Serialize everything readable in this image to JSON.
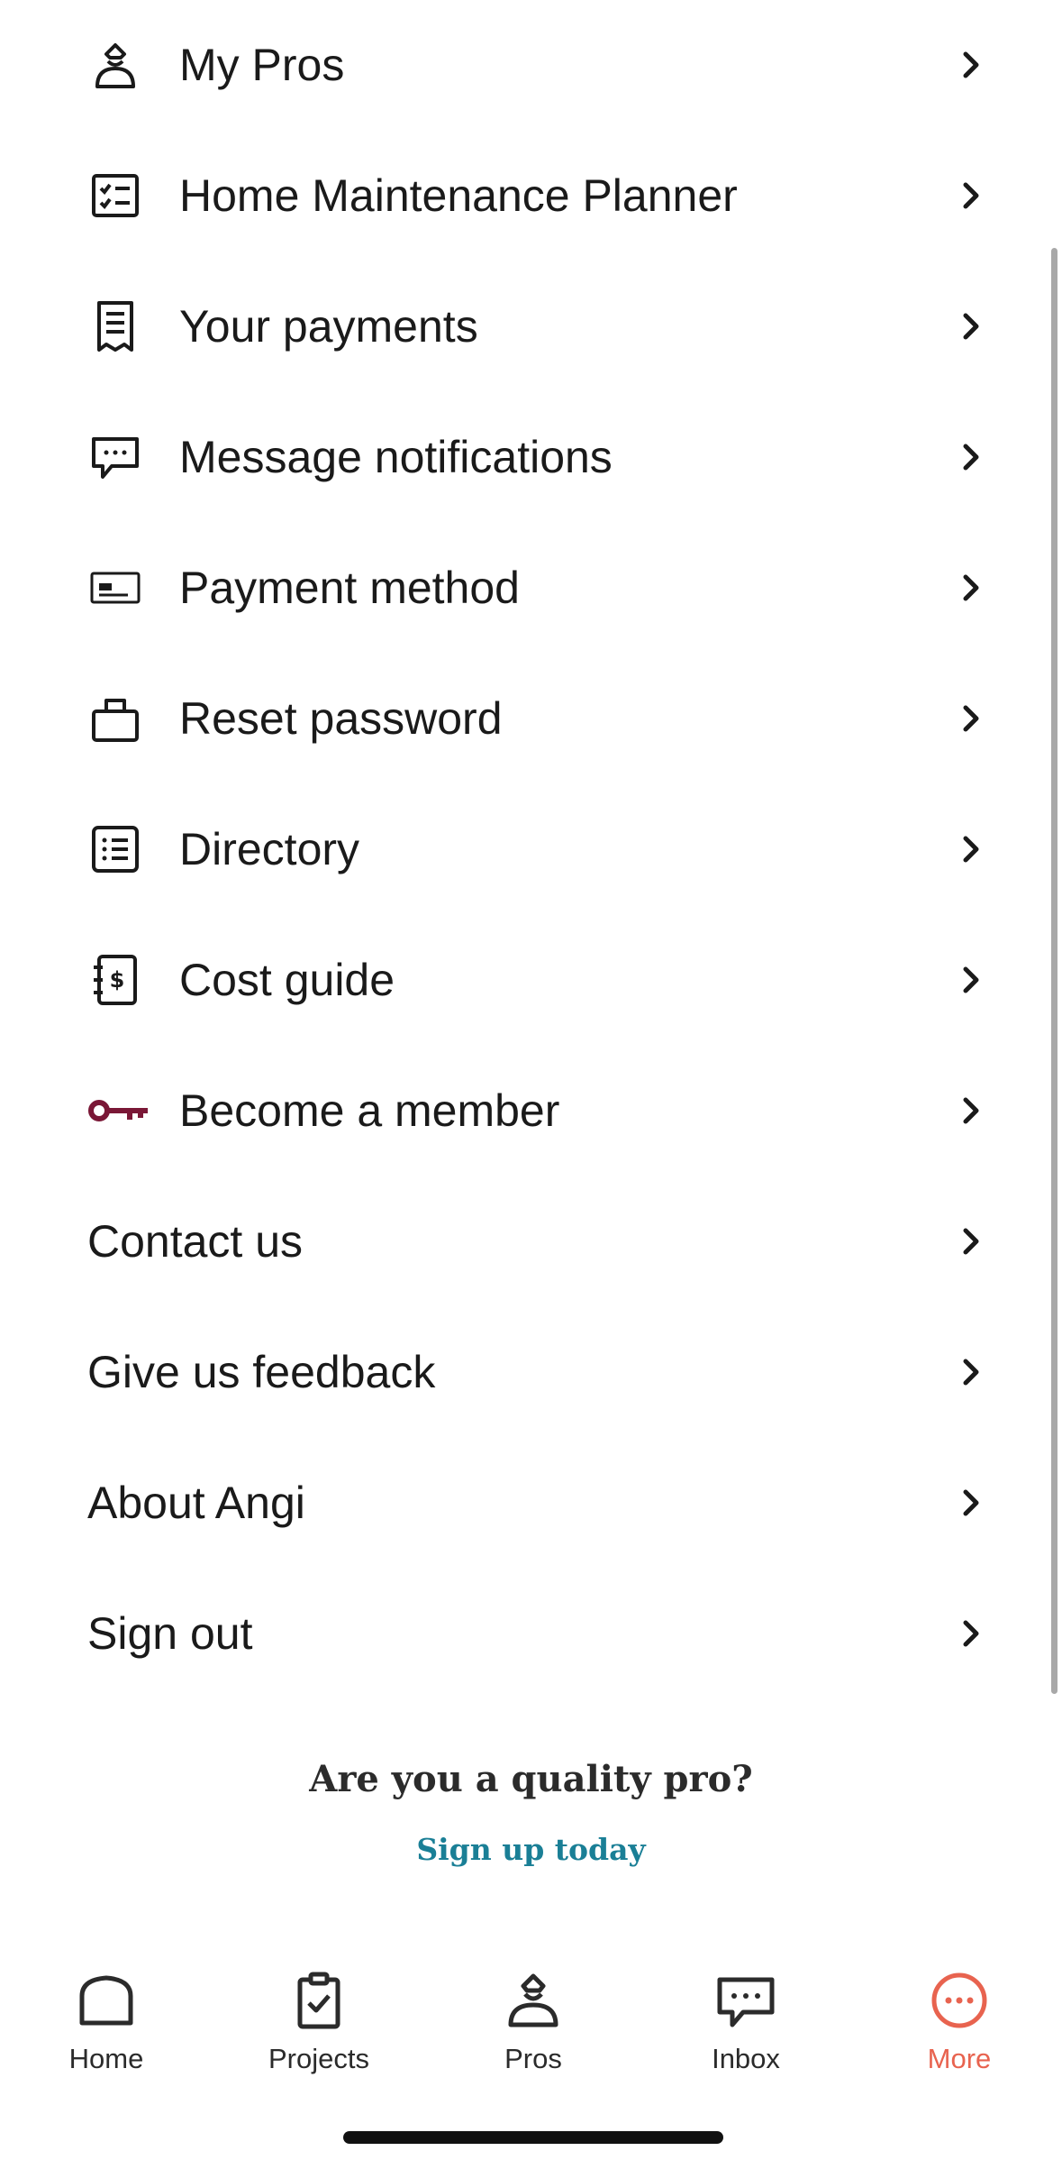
{
  "menu": {
    "items": [
      {
        "label": "My Pros",
        "icon": "pro-person-icon"
      },
      {
        "label": "Home Maintenance Planner",
        "icon": "checklist-icon"
      },
      {
        "label": "Your payments",
        "icon": "receipt-icon"
      },
      {
        "label": "Message notifications",
        "icon": "chat-bubble-icon"
      },
      {
        "label": "Payment method",
        "icon": "credit-card-icon"
      },
      {
        "label": "Reset password",
        "icon": "briefcase-icon"
      },
      {
        "label": "Directory",
        "icon": "list-icon"
      },
      {
        "label": "Cost guide",
        "icon": "cost-guide-icon"
      },
      {
        "label": "Become a member",
        "icon": "key-icon"
      },
      {
        "label": "Contact us"
      },
      {
        "label": "Give us feedback"
      },
      {
        "label": "About Angi"
      },
      {
        "label": "Sign out"
      }
    ]
  },
  "promo": {
    "title": "Are you a quality pro?",
    "link": "Sign up today"
  },
  "tabs": [
    {
      "label": "Home",
      "icon": "house-icon"
    },
    {
      "label": "Projects",
      "icon": "clipboard-check-icon"
    },
    {
      "label": "Pros",
      "icon": "pro-person-icon"
    },
    {
      "label": "Inbox",
      "icon": "chat-bubble-icon"
    },
    {
      "label": "More",
      "icon": "more-dots-icon",
      "active": true
    }
  ],
  "colors": {
    "text": "#1a1a1a",
    "link": "#1a7f96",
    "active_tab": "#e8634f",
    "member_key": "#7a1736"
  }
}
